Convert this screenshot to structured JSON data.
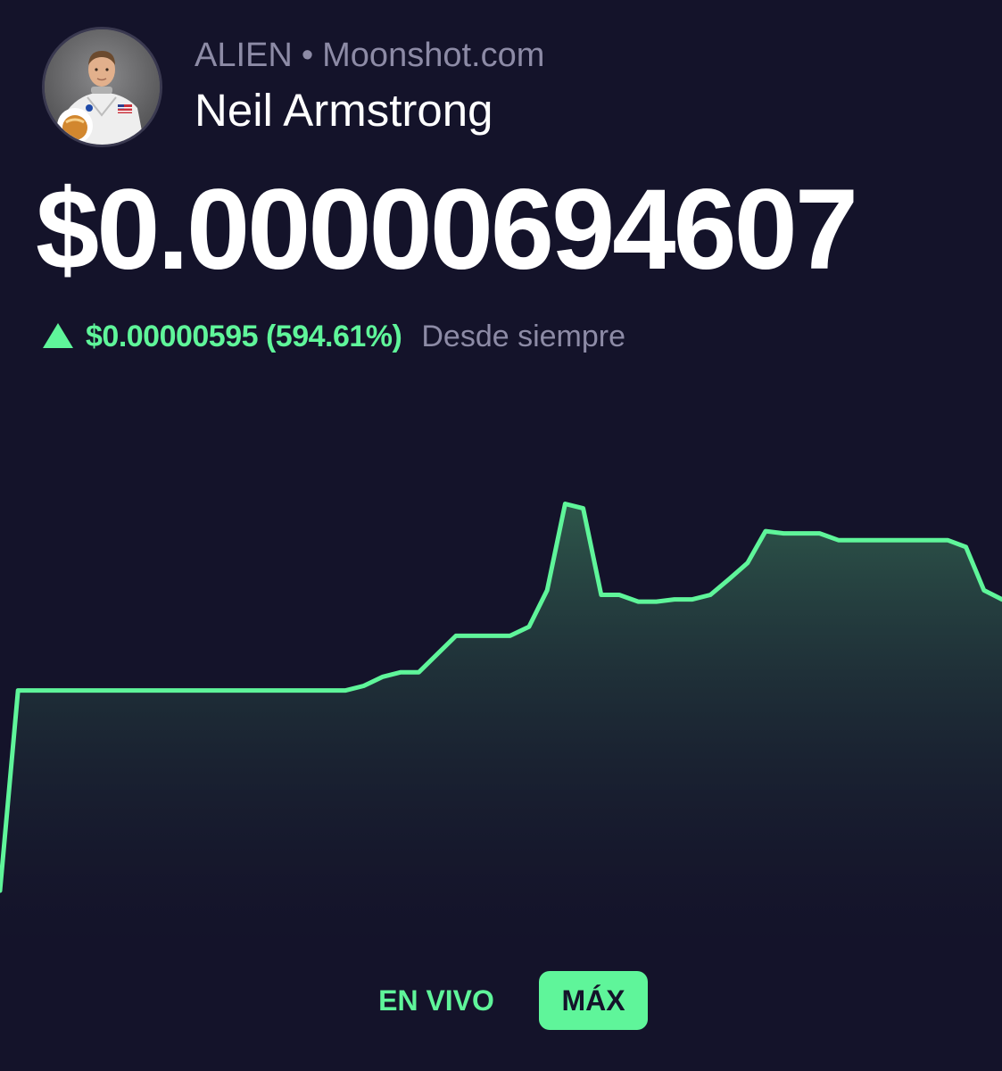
{
  "header": {
    "ticker": "ALIEN",
    "separator": "•",
    "source": "Moonshot.com",
    "name": "Neil Armstrong"
  },
  "price": {
    "value": "$0.00000694607",
    "change": "$0.00000595 (594.61%)",
    "period": "Desde siempre",
    "direction": "up"
  },
  "range_tabs": [
    {
      "label": "EN VIVO",
      "selected": false
    },
    {
      "label": "MÁX",
      "selected": true
    }
  ],
  "colors": {
    "background": "#14132a",
    "accent": "#5ff59a",
    "muted_text": "#8d8ba6",
    "primary_text": "#ffffff"
  },
  "icons": {
    "avatar": "astronaut-portrait-icon",
    "change": "triangle-up-icon"
  },
  "chart_data": {
    "type": "area",
    "x_range": [
      0,
      100
    ],
    "y_range": [
      0,
      100
    ],
    "grid": false,
    "points": [
      [
        0.0,
        0
      ],
      [
        1.8,
        44
      ],
      [
        34.5,
        44
      ],
      [
        36.3,
        45
      ],
      [
        38.2,
        47
      ],
      [
        40.0,
        48
      ],
      [
        41.8,
        48
      ],
      [
        45.5,
        56
      ],
      [
        50.9,
        56
      ],
      [
        52.8,
        58
      ],
      [
        54.6,
        66
      ],
      [
        56.4,
        85
      ],
      [
        58.2,
        84
      ],
      [
        60.0,
        65
      ],
      [
        61.8,
        65
      ],
      [
        63.7,
        63.5
      ],
      [
        65.5,
        63.5
      ],
      [
        67.3,
        64
      ],
      [
        69.1,
        64
      ],
      [
        70.9,
        65
      ],
      [
        72.8,
        68.5
      ],
      [
        74.6,
        72
      ],
      [
        76.4,
        79
      ],
      [
        78.2,
        78.5
      ],
      [
        81.8,
        78.5
      ],
      [
        83.7,
        77
      ],
      [
        94.6,
        77
      ],
      [
        96.4,
        75.5
      ],
      [
        98.2,
        66
      ],
      [
        100.0,
        64
      ]
    ]
  }
}
